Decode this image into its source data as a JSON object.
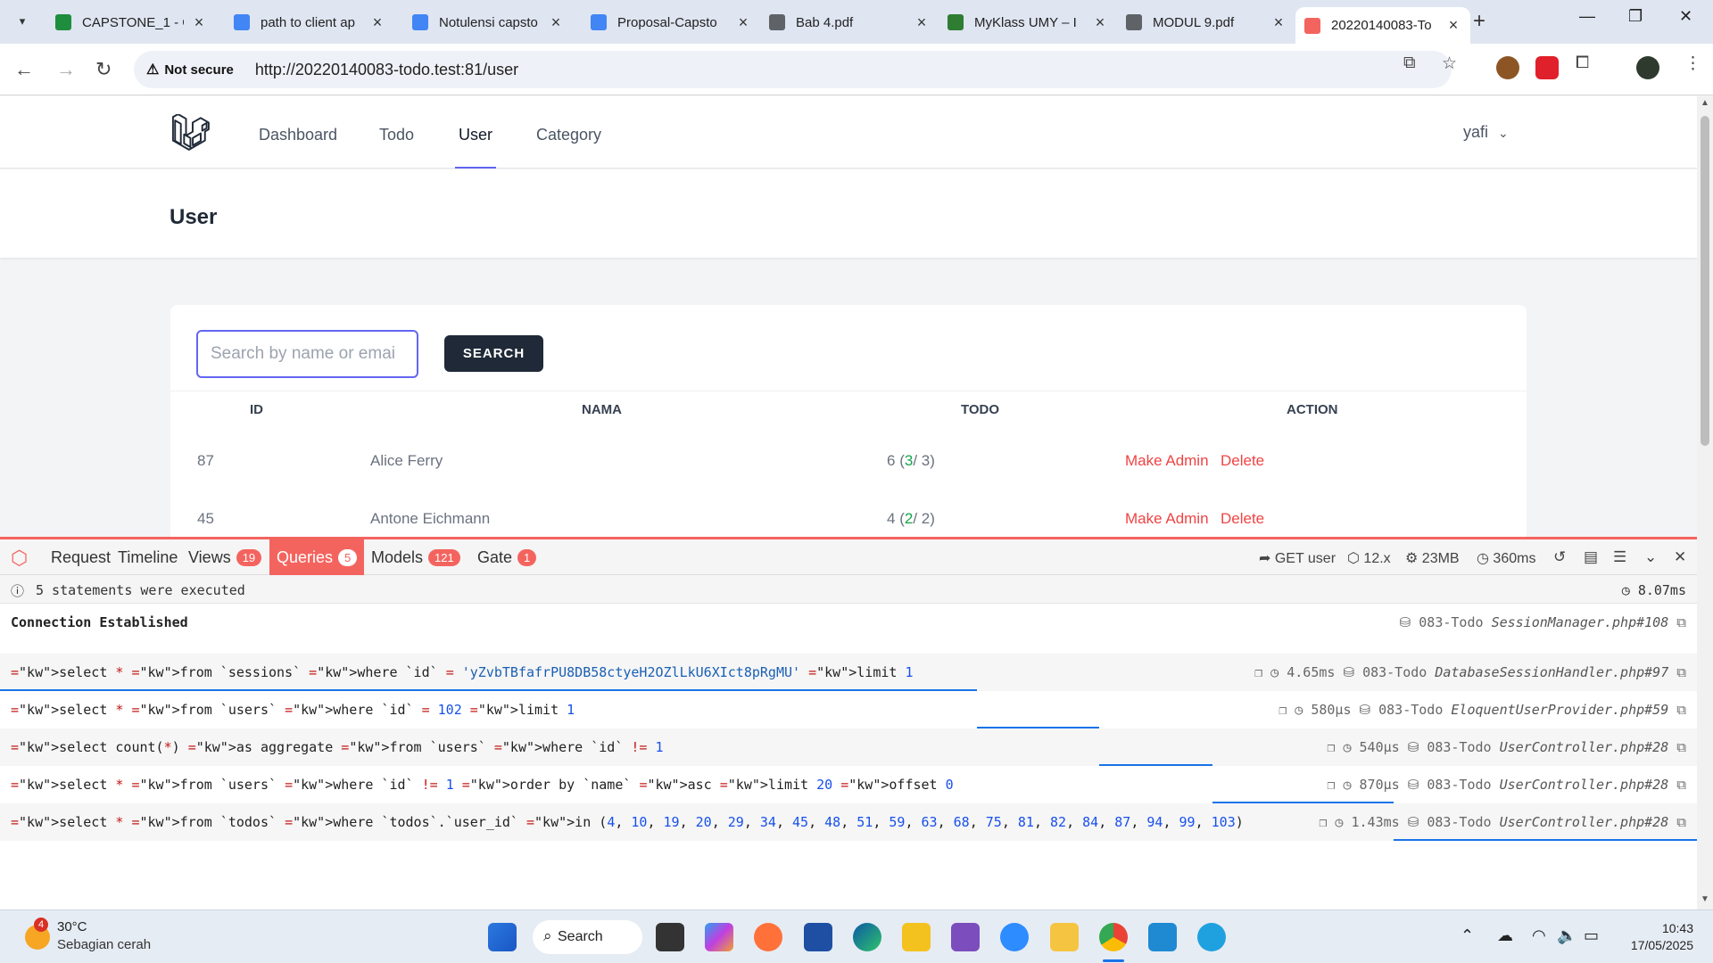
{
  "browser": {
    "tabs": [
      {
        "title": "CAPSTONE_1 - G",
        "color": "#1e8e3e"
      },
      {
        "title": "path to client ap",
        "color": "#4285f4"
      },
      {
        "title": "Notulensi capsto",
        "color": "#4285f4"
      },
      {
        "title": "Proposal-Capsto",
        "color": "#4285f4"
      },
      {
        "title": "Bab 4.pdf",
        "color": "#5f6368"
      },
      {
        "title": "MyKlass UMY – I",
        "color": "#2e7d32"
      },
      {
        "title": "MODUL 9.pdf",
        "color": "#5f6368"
      },
      {
        "title": "20220140083-To",
        "color": "#f4645f"
      }
    ],
    "security_label": "Not secure",
    "url": "http://20220140083-todo.test:81/user"
  },
  "app": {
    "nav": [
      "Dashboard",
      "Todo",
      "User",
      "Category"
    ],
    "active_nav": "User",
    "user_name": "yafi",
    "user_chevron": "⌄",
    "page_title": "User",
    "search_placeholder": "Search by name or emai",
    "search_button": "SEARCH",
    "columns": [
      "ID",
      "NAMA",
      "TODO",
      "ACTION"
    ],
    "rows": [
      {
        "id": "87",
        "name": "Alice Ferry",
        "todo_total": "6",
        "todo_done": "3",
        "todo_pending": "3"
      },
      {
        "id": "45",
        "name": "Antone Eichmann",
        "todo_total": "4",
        "todo_done": "2",
        "todo_pending": "2"
      }
    ],
    "actions": {
      "make_admin": "Make Admin",
      "delete": "Delete"
    }
  },
  "debugbar": {
    "tabs": [
      {
        "label": "Request",
        "badge": ""
      },
      {
        "label": "Timeline",
        "badge": ""
      },
      {
        "label": "Views",
        "badge": "19"
      },
      {
        "label": "Queries",
        "badge": "5"
      },
      {
        "label": "Models",
        "badge": "121"
      },
      {
        "label": "Gate",
        "badge": "1"
      }
    ],
    "active_tab": "Queries",
    "method": "GET user",
    "version": "12.x",
    "memory": "23MB",
    "duration": "360ms",
    "summary": "5 statements were executed",
    "summary_time": "8.07ms",
    "connection": "Connection Established",
    "connection_meta": "083-Todo",
    "connection_source": "SessionManager.php#108",
    "queries": [
      {
        "sql": "select * from `sessions` where `id` = 'yZvbTBfafrPU8DB58ctyeH2OZlLkU6XIct8pRgMU' limit 1",
        "time": "4.65ms",
        "conn": "083-Todo",
        "source": "DatabaseSessionHandler.php#97"
      },
      {
        "sql": "select * from `users` where `id` = 102 limit 1",
        "time": "580μs",
        "conn": "083-Todo",
        "source": "EloquentUserProvider.php#59"
      },
      {
        "sql": "select count(*) as aggregate from `users` where `id` != 1",
        "time": "540μs",
        "conn": "083-Todo",
        "source": "UserController.php#28"
      },
      {
        "sql": "select * from `users` where `id` != 1 order by `name` asc limit 20 offset 0",
        "time": "870μs",
        "conn": "083-Todo",
        "source": "UserController.php#28"
      },
      {
        "sql": "select * from `todos` where `todos`.`user_id` in (4, 10, 19, 20, 29, 34, 45, 48, 51, 59, 63, 68, 75, 81, 82, 84, 87, 94, 99, 103)",
        "time": "1.43ms",
        "conn": "083-Todo",
        "source": "UserController.php#28"
      }
    ]
  },
  "taskbar": {
    "weather_badge": "4",
    "temperature": "30°C",
    "weather_desc": "Sebagian cerah",
    "search_label": "Search",
    "time": "10:43",
    "date": "17/05/2025"
  }
}
